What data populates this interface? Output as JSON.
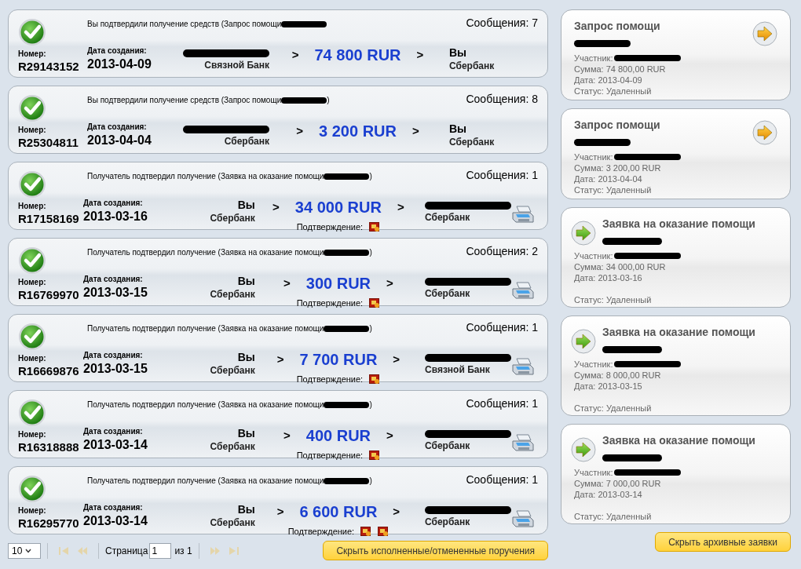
{
  "payments": [
    {
      "status": "Вы подтвердили получение средств (Запрос помощи",
      "messages": "Сообщения: 7",
      "number_label": "Номер:",
      "number": "R29143152",
      "date_label": "Дата создания:",
      "date": "2013-04-09",
      "from": {
        "bank": "Связной Банк"
      },
      "arrow_in": ">",
      "amount": "74 800 RUR",
      "arrow_out": ">",
      "to": {
        "name": "Вы",
        "bank": "Сбербанк"
      },
      "printable": false
    },
    {
      "status": "Вы подтвердили получение средств (Запрос помощи",
      "status_tail": ")",
      "messages": "Сообщения: 8",
      "number_label": "Номер:",
      "number": "R25304811",
      "date_label": "Дата создания:",
      "date": "2013-04-04",
      "from": {
        "bank": "Сбербанк"
      },
      "arrow_in": ">",
      "amount": "3 200 RUR",
      "arrow_out": ">",
      "to": {
        "name": "Вы",
        "bank": "Сбербанк"
      },
      "printable": false
    },
    {
      "status": "Получатель подтвердил получение (Заявка на оказание помощи",
      "status_tail": ")",
      "messages": "Сообщения: 1",
      "number_label": "Номер:",
      "number": "R17158169",
      "date_label": "Дата создания:",
      "date": "2013-03-16",
      "from": {
        "name": "Вы",
        "bank": "Сбербанк"
      },
      "arrow_in": ">",
      "amount": "34 000 RUR",
      "arrow_out": ">",
      "to": {
        "bank": "Сбербанк"
      },
      "confirmation": {
        "label": "Подтверждение:",
        "attachments": [
          {
            "kind": "scan"
          }
        ]
      },
      "printable": true
    },
    {
      "status": "Получатель подтвердил получение (Заявка на оказание помощи",
      "status_tail": ")",
      "messages": "Сообщения: 2",
      "number_label": "Номер:",
      "number": "R16769970",
      "date_label": "Дата создания:",
      "date": "2013-03-15",
      "from": {
        "name": "Вы",
        "bank": "Сбербанк"
      },
      "arrow_in": ">",
      "amount": "300 RUR",
      "arrow_out": ">",
      "to": {
        "bank": "Сбербанк"
      },
      "confirmation": {
        "label": "Подтверждение:",
        "attachments": [
          {
            "kind": "scan"
          }
        ]
      },
      "printable": true
    },
    {
      "status": "Получатель подтвердил получение (Заявка на оказание помощи",
      "status_tail": ")",
      "messages": "Сообщения: 1",
      "number_label": "Номер:",
      "number": "R16669876",
      "date_label": "Дата создания:",
      "date": "2013-03-15",
      "from": {
        "name": "Вы",
        "bank": "Сбербанк"
      },
      "arrow_in": ">",
      "amount": "7 700 RUR",
      "arrow_out": ">",
      "to": {
        "bank": "Связной Банк"
      },
      "confirmation": {
        "label": "Подтверждение:",
        "attachments": [
          {
            "kind": "scan"
          }
        ]
      },
      "printable": true
    },
    {
      "status": "Получатель подтвердил получение (Заявка на оказание помощи",
      "status_tail": ")",
      "messages": "Сообщения: 1",
      "number_label": "Номер:",
      "number": "R16318888",
      "date_label": "Дата создания:",
      "date": "2013-03-14",
      "from": {
        "name": "Вы",
        "bank": "Сбербанк"
      },
      "arrow_in": ">",
      "amount": "400 RUR",
      "arrow_out": ">",
      "to": {
        "bank": "Сбербанк"
      },
      "confirmation": {
        "label": "Подтверждение:",
        "attachments": [
          {
            "kind": "scan"
          }
        ]
      },
      "printable": true
    },
    {
      "status": "Получатель подтвердил получение (Заявка на оказание помощи",
      "status_tail": ")",
      "messages": "Сообщения: 1",
      "number_label": "Номер:",
      "number": "R16295770",
      "date_label": "Дата создания:",
      "date": "2013-03-14",
      "from": {
        "name": "Вы",
        "bank": "Сбербанк"
      },
      "arrow_in": ">",
      "amount": "6 600 RUR",
      "arrow_out": ">",
      "to": {
        "bank": "Сбербанк"
      },
      "confirmation": {
        "label": "Подтверждение:",
        "attachments": [
          {
            "kind": "scan"
          },
          {
            "kind": "scan"
          }
        ]
      },
      "printable": true
    }
  ],
  "pager": {
    "page_size": "10",
    "page_label": "Страница",
    "page": "1",
    "of_label": "из 1",
    "first_disabled": true,
    "prev_disabled": true,
    "next_disabled": true,
    "last_disabled": true
  },
  "hide_done_button": "Скрыть исполненные/отмененные поручения",
  "archive": [
    {
      "kind": "request",
      "title": "Запрос помощи",
      "participant": "Участник:",
      "sum": "Сумма: 74 800,00 RUR",
      "date": "Дата: 2013-04-09",
      "status": "Статус: Удаленный"
    },
    {
      "kind": "request",
      "title": "Запрос помощи",
      "participant": "Участник:",
      "sum": "Сумма: 3 200,00 RUR",
      "date": "Дата: 2013-04-04",
      "status": "Статус: Удаленный"
    },
    {
      "kind": "offer",
      "title": "Заявка на оказание помощи",
      "participant": "Участник:",
      "sum": "Сумма: 34 000,00 RUR",
      "date": "Дата: 2013-03-16",
      "status": "Статус: Удаленный"
    },
    {
      "kind": "offer",
      "title": "Заявка на оказание помощи",
      "participant": "Участник:",
      "sum": "Сумма: 8 000,00 RUR",
      "date": "Дата: 2013-03-15",
      "status": "Статус: Удаленный"
    },
    {
      "kind": "offer",
      "title": "Заявка на оказание помощи",
      "participant": "Участник:",
      "sum": "Сумма: 7 000,00 RUR",
      "date": "Дата: 2013-03-14",
      "status": "Статус: Удаленный"
    }
  ],
  "hide_archive_button": "Скрыть архивные заявки"
}
